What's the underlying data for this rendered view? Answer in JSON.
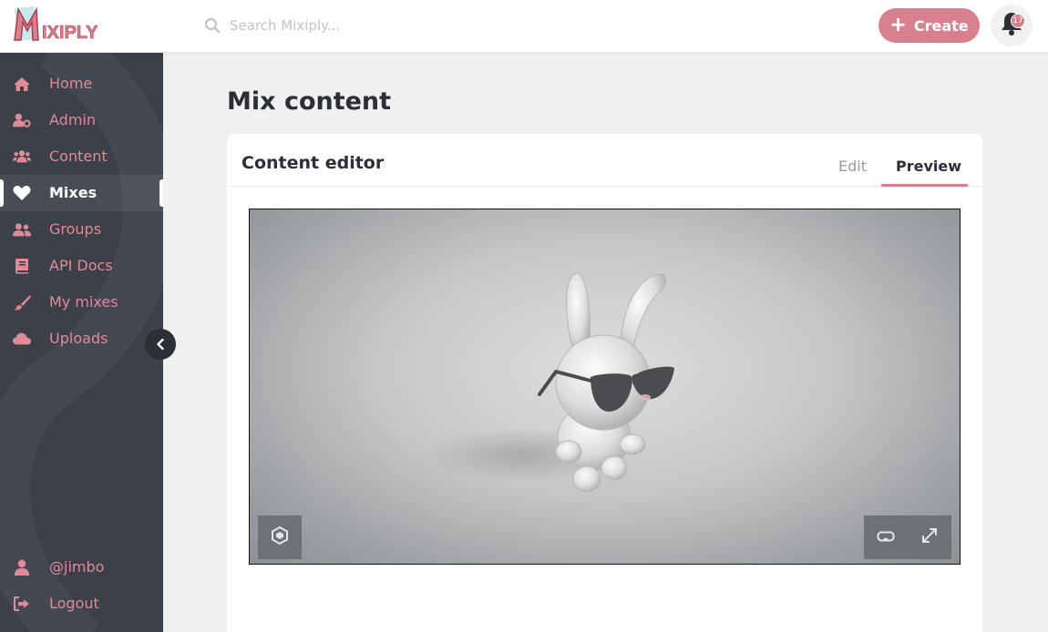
{
  "brand": {
    "logo_text": "MIXIPLY",
    "accent": "#d9808f",
    "sidebar_bg": "#3b4049"
  },
  "header": {
    "search_placeholder": "Search Mixiply...",
    "create_label": "Create",
    "notification_count": "17"
  },
  "sidebar": {
    "items": [
      {
        "label": "Home",
        "icon": "home-icon"
      },
      {
        "label": "Admin",
        "icon": "user-gear-icon"
      },
      {
        "label": "Content",
        "icon": "users-gear-icon"
      },
      {
        "label": "Mixes",
        "icon": "heart-icon",
        "active": true
      },
      {
        "label": "Groups",
        "icon": "users-icon"
      },
      {
        "label": "API Docs",
        "icon": "book-icon"
      },
      {
        "label": "My mixes",
        "icon": "brush-icon"
      },
      {
        "label": "Uploads",
        "icon": "cloud-icon"
      }
    ],
    "footer": [
      {
        "label": "@jimbo",
        "icon": "user-icon"
      },
      {
        "label": "Logout",
        "icon": "logout-icon"
      }
    ]
  },
  "main": {
    "page_title": "Mix content",
    "card_title": "Content editor",
    "tabs": [
      {
        "label": "Edit",
        "active": false
      },
      {
        "label": "Preview",
        "active": true
      }
    ]
  },
  "viewer": {
    "buttons": [
      "ar-icon",
      "vr-headset-icon",
      "fullscreen-icon"
    ]
  }
}
